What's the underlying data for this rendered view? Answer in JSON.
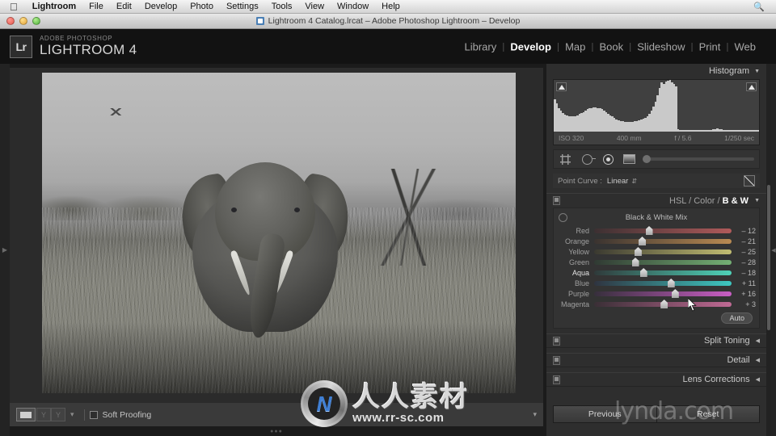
{
  "os_menu": {
    "apple_icon": "apple-icon",
    "items": [
      "Lightroom",
      "File",
      "Edit",
      "Develop",
      "Photo",
      "Settings",
      "Tools",
      "View",
      "Window",
      "Help"
    ],
    "search_icon": "search-icon"
  },
  "window": {
    "title": "Lightroom 4 Catalog.lrcat – Adobe Photoshop Lightroom – Develop",
    "doc_icon": "catalog-icon",
    "close_label": "",
    "minimize_label": "",
    "zoom_label": ""
  },
  "identity": {
    "badge": "Lr",
    "superscript": "ADOBE PHOTOSHOP",
    "product": "LIGHTROOM 4"
  },
  "modules": {
    "items": [
      "Library",
      "Develop",
      "Map",
      "Book",
      "Slideshow",
      "Print",
      "Web"
    ],
    "active": "Develop",
    "separator": "|"
  },
  "histogram": {
    "panel_title": "Histogram",
    "caret": "▼",
    "clip_shadow_icon": "shadow-clipping-icon",
    "clip_highlight_icon": "highlight-clipping-icon",
    "meta": {
      "iso": "ISO 320",
      "focal": "400 mm",
      "aperture": "f / 5.6",
      "shutter": "1/250 sec"
    },
    "bins": [
      62,
      55,
      45,
      40,
      36,
      33,
      31,
      30,
      29,
      29,
      30,
      32,
      34,
      36,
      38,
      41,
      43,
      45,
      46,
      47,
      47,
      46,
      45,
      43,
      41,
      38,
      35,
      32,
      29,
      26,
      24,
      22,
      21,
      20,
      19,
      19,
      18,
      18,
      19,
      20,
      21,
      22,
      23,
      25,
      27,
      30,
      34,
      40,
      48,
      58,
      70,
      84,
      96,
      92,
      97,
      99,
      100,
      96,
      92,
      88,
      4,
      3,
      3,
      3,
      3,
      3,
      3,
      3,
      3,
      3,
      3,
      3,
      3,
      3,
      3,
      3,
      3,
      4,
      5,
      6,
      5,
      4,
      3,
      3,
      3,
      3,
      3,
      3,
      3,
      3,
      3,
      3,
      3,
      3,
      3,
      3,
      3,
      3,
      3,
      3
    ]
  },
  "tools": {
    "crop_icon": "crop-overlay-icon",
    "spot_icon": "spot-removal-icon",
    "redeye_icon": "red-eye-correction-icon",
    "graduated_icon": "graduated-filter-icon",
    "brush_slider_label": "adjustment-brush-slider"
  },
  "point_curve": {
    "label": "Point Curve :",
    "value": "Linear",
    "stepper_icon": "stepper-arrows-icon",
    "target_icon": "tone-curve-target-icon"
  },
  "hsl_panel": {
    "switch_icon": "panel-switch-icon",
    "tab_hsl": "HSL",
    "tab_color": "Color",
    "tab_bw": "B & W",
    "separator": "/",
    "caret": "◀",
    "target_adjust_icon": "targeted-adjustment-icon",
    "section_title": "Black & White Mix",
    "auto_label": "Auto",
    "sliders": [
      {
        "name": "Red",
        "value": "– 12",
        "pos": 40,
        "color_from": "#3c3032",
        "color_to": "#b05a5a"
      },
      {
        "name": "Orange",
        "value": "– 21",
        "pos": 35,
        "color_from": "#3a3330",
        "color_to": "#b98a52"
      },
      {
        "name": "Yellow",
        "value": "– 25",
        "pos": 32,
        "color_from": "#3a3930",
        "color_to": "#c2bd72"
      },
      {
        "name": "Green",
        "value": "– 28",
        "pos": 30,
        "color_from": "#303a33",
        "color_to": "#74b074"
      },
      {
        "name": "Aqua",
        "value": "– 18",
        "pos": 36,
        "color_from": "#2f3a3a",
        "color_to": "#4fd2b8"
      },
      {
        "name": "Blue",
        "value": "+ 11",
        "pos": 56,
        "color_from": "#2f3440",
        "color_to": "#3ec7c1"
      },
      {
        "name": "Purple",
        "value": "+ 16",
        "pos": 59,
        "color_from": "#372f3c",
        "color_to": "#c95ec4"
      },
      {
        "name": "Magenta",
        "value": "+ 3",
        "pos": 51,
        "color_from": "#3a2f36",
        "color_to": "#c06a94"
      }
    ],
    "highlight_slider": "Aqua"
  },
  "collapsed_panels": [
    {
      "title": "Split Toning",
      "caret": "◀",
      "switch_icon": "panel-switch-icon"
    },
    {
      "title": "Detail",
      "caret": "◀",
      "switch_icon": "panel-switch-icon"
    },
    {
      "title": "Lens Corrections",
      "caret": "◀",
      "switch_icon": "panel-switch-icon"
    }
  ],
  "bottom_buttons": {
    "previous": "Previous",
    "reset": "Reset"
  },
  "photo_toolbar": {
    "loupe_icon": "loupe-view-icon",
    "compare_icon": "compare-view-icon",
    "survey_icon": "survey-view-icon",
    "caret": "▾",
    "soft_proofing_label": "Soft Proofing",
    "soft_proofing_checkbox": "soft-proofing-checkbox",
    "panel_caret": "▾"
  },
  "photo": {
    "subject": "black-and-white photo of an elephant in tall grass",
    "bird_icon": "bird-in-sky"
  },
  "watermarks": {
    "center_cn": "人人素材",
    "center_url": "www.rr-sc.com",
    "center_logo": "rr-sc-logo",
    "corner": "lynda.com"
  },
  "colors": {
    "panel_bg": "#2e2e2e",
    "app_bg": "#1b1b1b",
    "accent_text": "#ffffff",
    "muted_text": "#a0a0a0"
  }
}
